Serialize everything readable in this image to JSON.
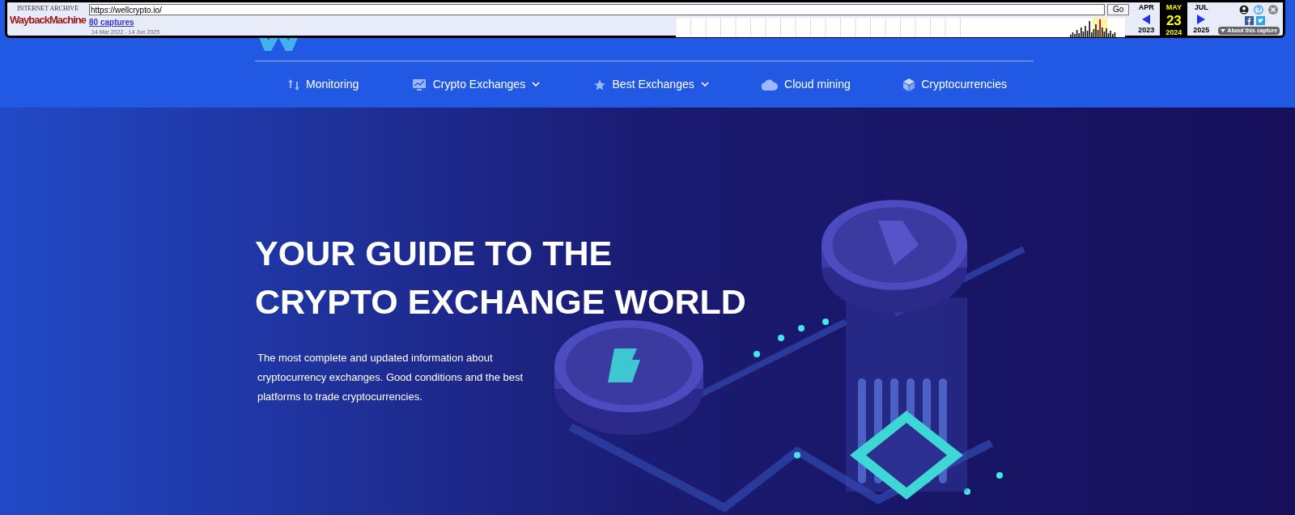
{
  "wayback": {
    "archive_label": "INTERNET ARCHIVE",
    "logo": "WaybackMachine",
    "url": "https://wellcrypto.io/",
    "go": "Go",
    "captures": "80 captures",
    "range": "14 Mar 2022 - 14 Jun 2025",
    "months": [
      {
        "month": "APR",
        "year": "2023",
        "selected": false
      },
      {
        "month": "MAY",
        "day": "23",
        "year": "2024",
        "selected": true
      },
      {
        "month": "JUL",
        "year": "2025",
        "selected": false
      }
    ],
    "about": "About this capture"
  },
  "nav": [
    {
      "label": "Monitoring",
      "kind": "arrows",
      "dropdown": false
    },
    {
      "label": "Crypto Exchanges",
      "kind": "monitor",
      "dropdown": true
    },
    {
      "label": "Best Exchanges",
      "kind": "star",
      "dropdown": true
    },
    {
      "label": "Cloud mining",
      "kind": "cloud",
      "dropdown": false
    },
    {
      "label": "Cryptocurrencies",
      "kind": "cube",
      "dropdown": false
    }
  ],
  "hero": {
    "title_lines": [
      "YOUR GUIDE TO THE",
      "CRYPTO EXCHANGE WORLD"
    ],
    "text": "The most complete and updated information about cryptocurrency exchanges. Good conditions and the best platforms to trade cryptocurrencies."
  }
}
